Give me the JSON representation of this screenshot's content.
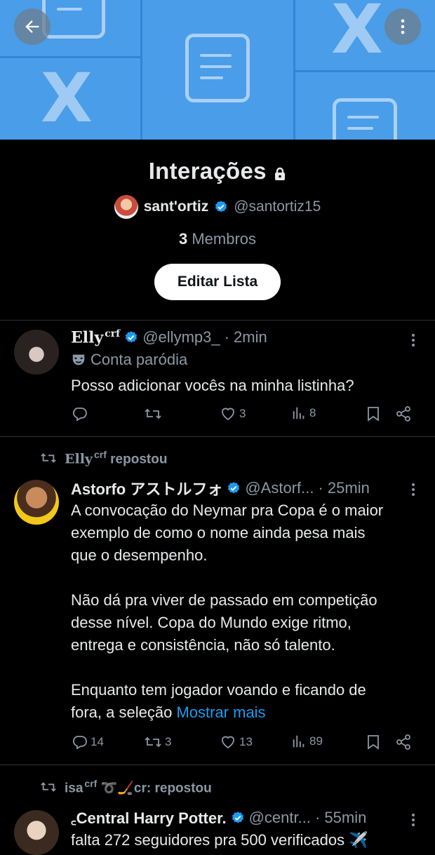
{
  "list": {
    "title": "Interações",
    "owner_name": "sant'ortiz",
    "owner_handle": "@santortiz15",
    "member_count": "3",
    "member_label": "Membros",
    "edit_button": "Editar Lista"
  },
  "tweets": [
    {
      "name": "Elly",
      "name_sup": "crf",
      "handle": "@ellymp3_",
      "time": "· 2min",
      "label": "Conta paródia",
      "text": "Posso adicionar vocês na minha listinha?",
      "replies": "",
      "retweets": "",
      "likes": "3",
      "views": "8"
    },
    {
      "repost_name": "Elly",
      "repost_sup": "crf",
      "repost_label": "repostou",
      "name": "Astorfo アストルフォ",
      "handle": "@Astorf...",
      "time": "· 25min",
      "text_lines": [
        "A convocação do Neymar pra Copa é o maior",
        "exemplo de como o nome ainda pesa mais",
        "que o desempenho.",
        "",
        "Não dá pra viver de passado em competição",
        "desse nível. Copa do Mundo exige ritmo,",
        "entrega e consistência, não só talento.",
        "",
        "Enquanto tem jogador voando e ficando de"
      ],
      "last_line": "fora, a seleção",
      "show_more": "Mostrar mais",
      "replies": "14",
      "retweets": "3",
      "likes": "13",
      "views": "89"
    },
    {
      "repost_name": "isa",
      "repost_sup": "crf",
      "repost_suffix": "➰🏒cr: repostou",
      "name": "꜀Central Harry Potter.",
      "handle": "@centr...",
      "time": "· 55min",
      "text": "falta 272 seguidores pra 500 verificados ✈️"
    }
  ],
  "colors": {
    "banner": "#4a9de8",
    "accent": "#1d9bf0",
    "verified": "#1d9bf0",
    "muted": "#8b98a5"
  },
  "icons": [
    "back-arrow-icon",
    "more-vertical-icon",
    "lock-icon",
    "verified-badge-icon",
    "mask-icon",
    "reply-icon",
    "retweet-icon",
    "like-icon",
    "views-icon",
    "bookmark-icon",
    "share-icon"
  ]
}
